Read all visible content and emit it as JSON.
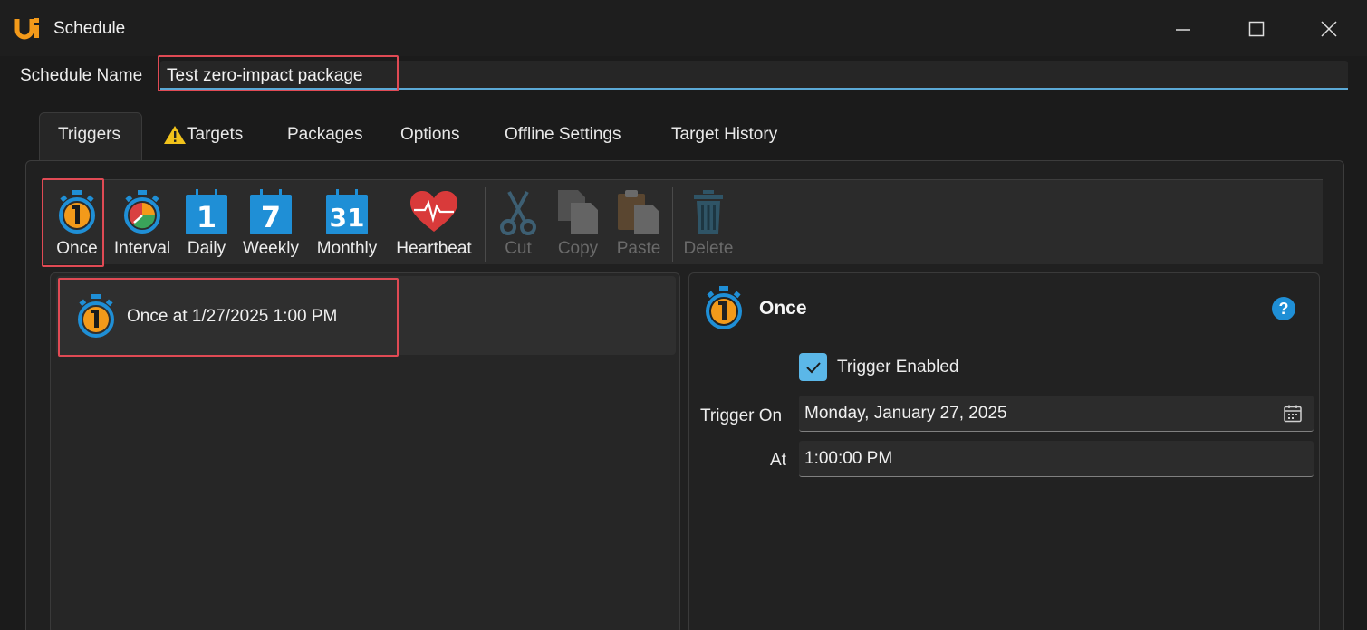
{
  "window": {
    "title": "Schedule"
  },
  "schedule_name": {
    "label": "Schedule Name",
    "value": "Test zero-impact package"
  },
  "tabs": [
    {
      "label": "Triggers",
      "active": true
    },
    {
      "label": "Targets",
      "warning": true
    },
    {
      "label": "Packages"
    },
    {
      "label": "Options"
    },
    {
      "label": "Offline Settings"
    },
    {
      "label": "Target History"
    }
  ],
  "toolbar": {
    "once": "Once",
    "interval": "Interval",
    "daily": "Daily",
    "daily_num": "1",
    "weekly": "Weekly",
    "weekly_num": "7",
    "monthly": "Monthly",
    "monthly_num": "31",
    "heartbeat": "Heartbeat",
    "cut": "Cut",
    "copy": "Copy",
    "paste": "Paste",
    "delete": "Delete"
  },
  "triggers_list": [
    {
      "text": "Once at 1/27/2025 1:00 PM"
    }
  ],
  "details": {
    "title": "Once",
    "help": "?",
    "enabled_label": "Trigger Enabled",
    "enabled": true,
    "trigger_on_label": "Trigger On",
    "trigger_on_value": "Monday, January 27, 2025",
    "at_label": "At",
    "at_value": "1:00:00 PM"
  },
  "colors": {
    "accent_blue": "#1f8fd6",
    "accent_orange": "#f39a1a",
    "highlight_red": "#e04a54",
    "checkbox": "#5bb7e8"
  }
}
